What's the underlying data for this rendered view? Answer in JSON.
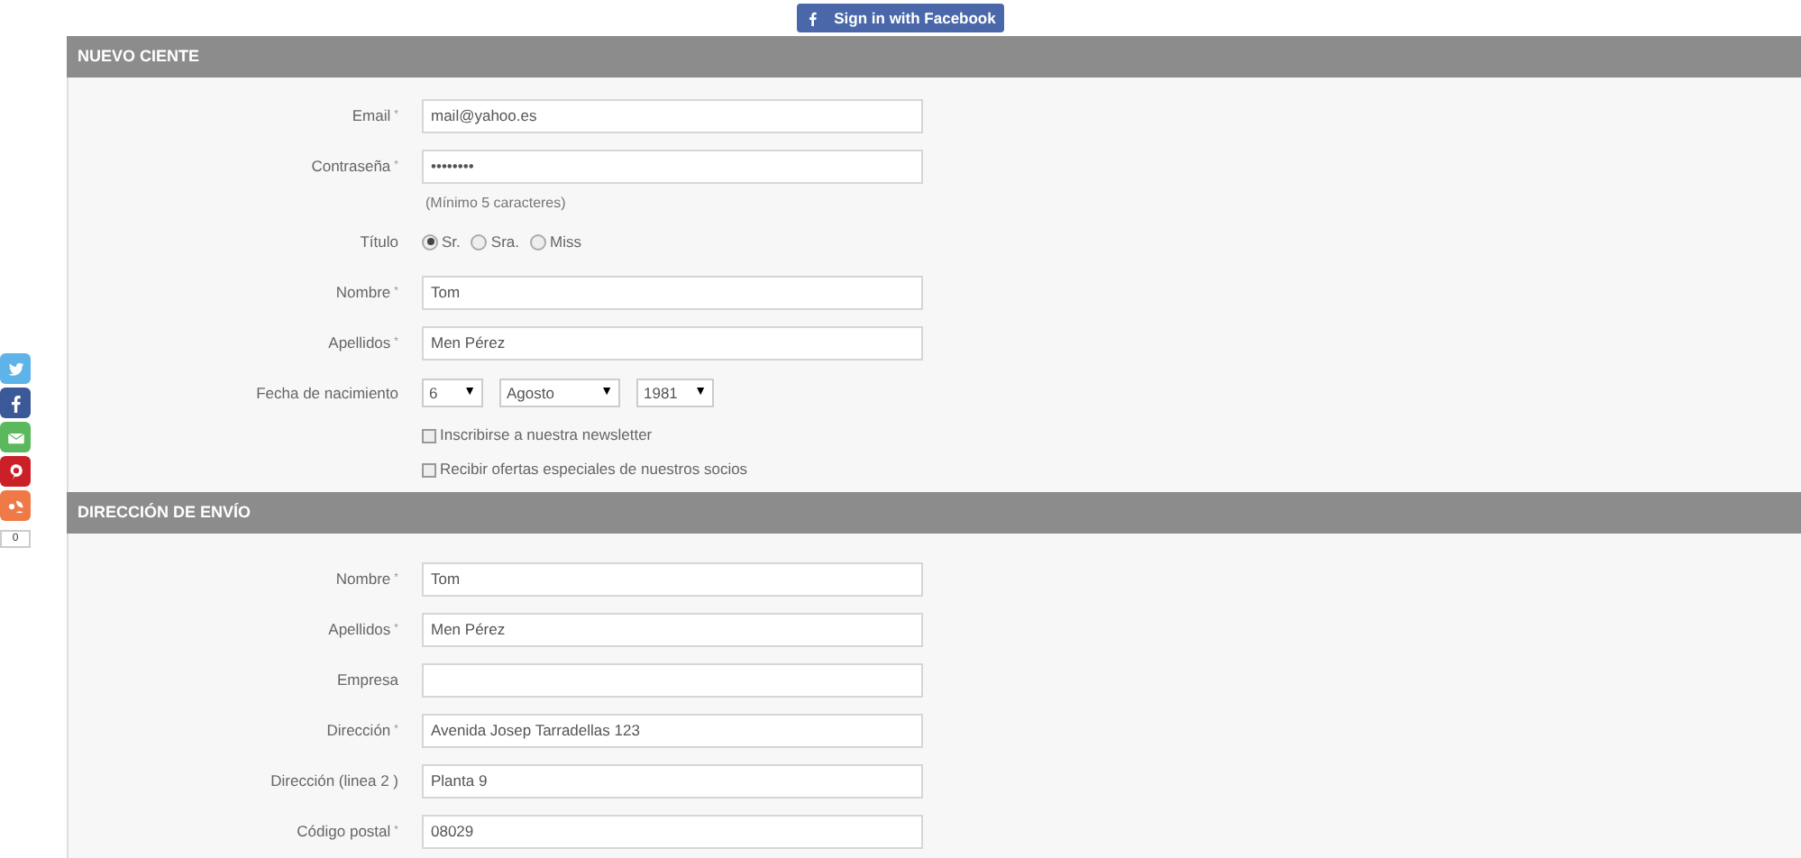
{
  "facebook_button": {
    "label": "Sign in with Facebook"
  },
  "share_bar": {
    "items": [
      {
        "kind": "twitter",
        "color": "#5eb4e8"
      },
      {
        "kind": "facebook",
        "color": "#3b5998"
      },
      {
        "kind": "email",
        "color": "#5cb85c"
      },
      {
        "kind": "pinterest",
        "color": "#cb2027"
      },
      {
        "kind": "other",
        "color": "#f07a47"
      }
    ],
    "count": "0"
  },
  "sections": [
    {
      "title": "NUEVO CIENTE",
      "rows": [
        {
          "kind": "text",
          "label": "Email",
          "mark": "*",
          "value": "mail@yahoo.es"
        },
        {
          "kind": "text",
          "label": "Contraseña",
          "mark": "*",
          "value": "••••••••"
        },
        {
          "kind": "hint",
          "text": "(Mínimo 5 caracteres)"
        },
        {
          "kind": "radio",
          "label": "Título",
          "options": [
            {
              "label": "Sr.",
              "selected": true
            },
            {
              "label": "Sra.",
              "selected": false
            },
            {
              "label": "Miss",
              "selected": false
            }
          ]
        },
        {
          "kind": "text",
          "label": "Nombre",
          "mark": "*",
          "value": "Tom"
        },
        {
          "kind": "text",
          "label": "Apellidos",
          "mark": "*",
          "value": "Men Pérez"
        },
        {
          "kind": "selects",
          "label": "Fecha de nacimiento",
          "selects": [
            {
              "value": "6",
              "arrow": "▼"
            },
            {
              "value": "Agosto",
              "arrow": "▼"
            },
            {
              "value": "1981",
              "arrow": "▼"
            }
          ]
        },
        {
          "kind": "checkbox",
          "label": "Inscribirse a nuestra newsletter",
          "checked": false
        },
        {
          "kind": "checkbox",
          "label": "Recibir ofertas especiales de nuestros socios",
          "checked": false
        }
      ]
    },
    {
      "title": "DIRECCIÓN DE ENVÍO",
      "rows": [
        {
          "kind": "text",
          "label": "Nombre",
          "mark": "*",
          "value": "Tom"
        },
        {
          "kind": "text",
          "label": "Apellidos",
          "mark": "*",
          "value": "Men Pérez"
        },
        {
          "kind": "text",
          "label": "Empresa"
        },
        {
          "kind": "text",
          "label": "Dirección",
          "mark": "*",
          "value": "Avenida Josep Tarradellas 123"
        },
        {
          "kind": "text",
          "label": "Dirección (linea 2 )",
          "value": "Planta 9"
        },
        {
          "kind": "text",
          "label": "Código postal",
          "mark": "*",
          "value": "08029"
        }
      ]
    }
  ]
}
